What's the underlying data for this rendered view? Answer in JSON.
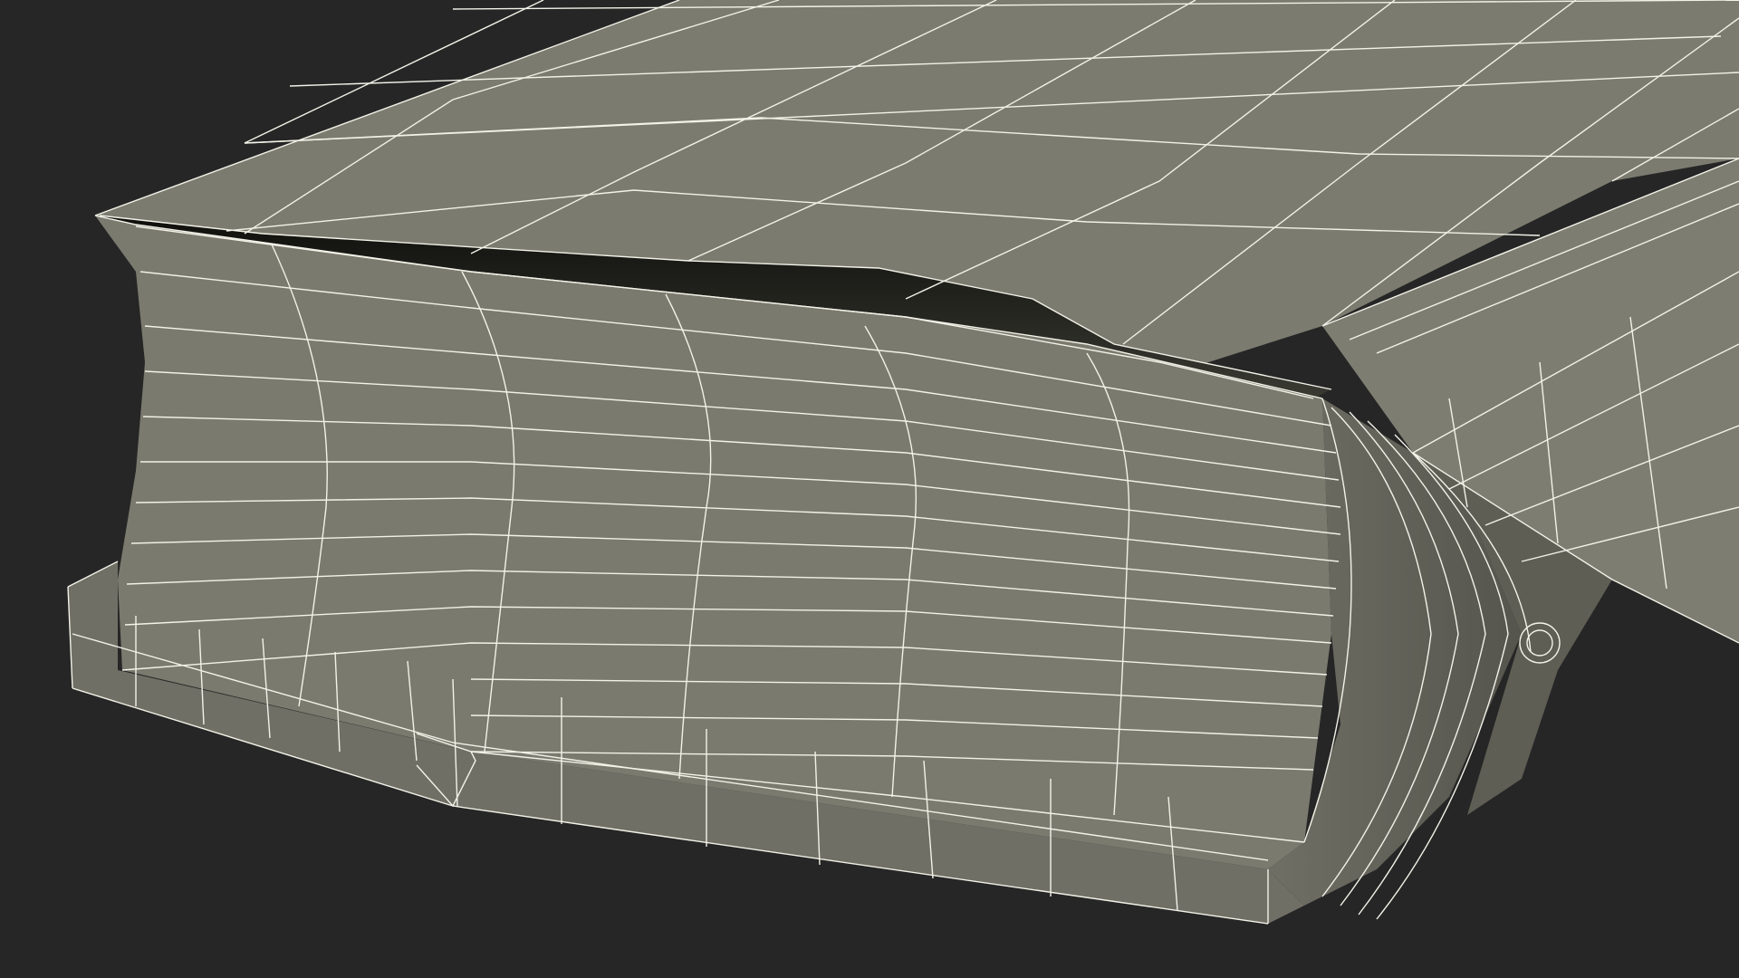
{
  "scene": {
    "subject": "wireframe-3d-model",
    "colors": {
      "background": "#262626",
      "surface": "#7b7b70",
      "surface_dark": "#5e5e55",
      "surface_shade": "#6a6a60",
      "gap": "#141411",
      "wire": "#f2f2e8"
    }
  }
}
